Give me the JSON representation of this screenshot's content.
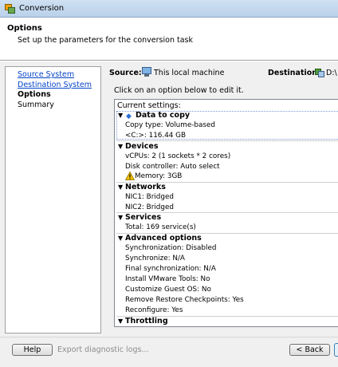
{
  "window": {
    "title": "Conversion"
  },
  "header": {
    "title": "Options",
    "subtitle": "Set up the parameters for the conversion task"
  },
  "nav": {
    "items": [
      {
        "label": "Source System",
        "state": "link"
      },
      {
        "label": "Destination System",
        "state": "link"
      },
      {
        "label": "Options",
        "state": "current"
      },
      {
        "label": "Summary",
        "state": "plain"
      }
    ]
  },
  "source": {
    "label": "Source:",
    "value": "This local machine",
    "icon": "computer-icon"
  },
  "destination": {
    "label": "Destination:",
    "value": "D:\\",
    "icon": "virtual-machine-icon"
  },
  "instruction": "Click on an option below to edit it.",
  "settings": {
    "header": "Current settings:",
    "sections": [
      {
        "title": "Data to copy",
        "icon": "diamond-icon",
        "items": [
          "Copy type: Volume-based",
          "<C:>: 116.44 GB"
        ]
      },
      {
        "title": "Devices",
        "items": [
          "vCPUs: 2 (1 sockets * 2 cores)",
          "Disk controller: Auto select",
          "Memory: 3GB"
        ]
      },
      {
        "title": "Networks",
        "items": [
          "NIC1: Bridged",
          "NIC2: Bridged"
        ]
      },
      {
        "title": "Services",
        "items": [
          "Total: 169 service(s)"
        ]
      },
      {
        "title": "Advanced options",
        "items": [
          "Synchronization: Disabled",
          "Synchronize: N/A",
          "Final synchronization: N/A",
          "Install VMware Tools: No",
          "Customize Guest OS: No",
          "Remove Restore Checkpoints: Yes",
          "Reconfigure: Yes"
        ]
      },
      {
        "title": "Throttling",
        "items": []
      }
    ]
  },
  "footer": {
    "help": "Help",
    "export": "Export diagnostic logs...",
    "back": "< Back"
  },
  "colors": {
    "link": "#0645c8",
    "disabled_text": "#8c8c8c",
    "titlebar": "#c4d8ee"
  }
}
